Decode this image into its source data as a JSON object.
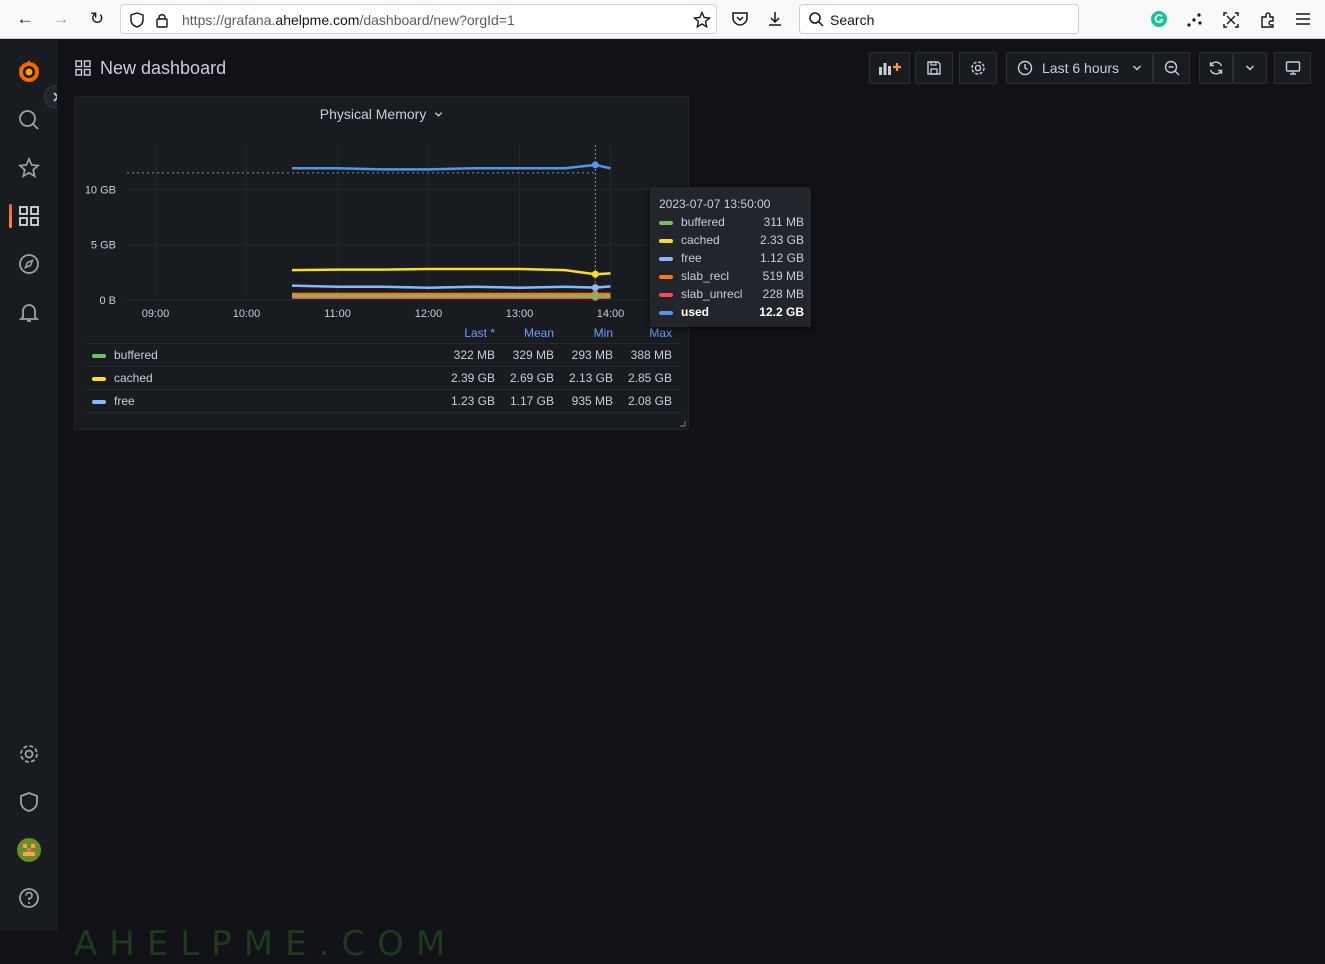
{
  "browser": {
    "url_prefix": "https://grafana.",
    "url_domain": "ahelpme.com",
    "url_path": "/dashboard/new?orgId=1",
    "search_placeholder": "Search"
  },
  "dashboard": {
    "title": "New dashboard",
    "time_range": "Last 6 hours"
  },
  "panel": {
    "title": "Physical Memory",
    "y_ticks": [
      "10 GB",
      "5 GB",
      "0 B"
    ],
    "x_ticks": [
      "09:00",
      "10:00",
      "11:00",
      "12:00",
      "13:00",
      "14:00"
    ]
  },
  "legend": {
    "headers": [
      "Last *",
      "Mean",
      "Min",
      "Max"
    ],
    "rows": [
      {
        "name": "buffered",
        "color": "#73bf69",
        "values": [
          "322 MB",
          "329 MB",
          "293 MB",
          "388 MB"
        ]
      },
      {
        "name": "cached",
        "color": "#fade2a",
        "values": [
          "2.39 GB",
          "2.69 GB",
          "2.13 GB",
          "2.85 GB"
        ]
      },
      {
        "name": "free",
        "color": "#8ab8ff",
        "values": [
          "1.23 GB",
          "1.17 GB",
          "935 MB",
          "2.08 GB"
        ]
      }
    ]
  },
  "tooltip": {
    "time": "2023-07-07 13:50:00",
    "rows": [
      {
        "name": "buffered",
        "color": "#73bf69",
        "value": "311 MB"
      },
      {
        "name": "cached",
        "color": "#fade2a",
        "value": "2.33 GB"
      },
      {
        "name": "free",
        "color": "#8ab8ff",
        "value": "1.12 GB"
      },
      {
        "name": "slab_recl",
        "color": "#ff780a",
        "value": "519 MB"
      },
      {
        "name": "slab_unrecl",
        "color": "#f2495c",
        "value": "228 MB"
      },
      {
        "name": "used",
        "color": "#5794f2",
        "value": "12.2 GB"
      }
    ]
  },
  "chart_data": {
    "type": "line",
    "ylim": [
      0,
      14
    ],
    "x": [
      "10:30",
      "11:00",
      "11:30",
      "12:00",
      "12:30",
      "13:00",
      "13:30",
      "13:50",
      "14:00"
    ],
    "series": [
      {
        "name": "used",
        "color": "#5794f2",
        "values": [
          11.9,
          11.9,
          11.8,
          11.8,
          11.9,
          11.9,
          11.9,
          12.2,
          11.9
        ]
      },
      {
        "name": "cached",
        "color": "#fade2a",
        "values": [
          2.7,
          2.75,
          2.75,
          2.8,
          2.8,
          2.8,
          2.7,
          2.33,
          2.4
        ]
      },
      {
        "name": "free",
        "color": "#8ab8ff",
        "values": [
          1.3,
          1.2,
          1.2,
          1.1,
          1.2,
          1.1,
          1.2,
          1.12,
          1.23
        ]
      },
      {
        "name": "slab_recl",
        "color": "#ff780a",
        "values": [
          0.52,
          0.52,
          0.52,
          0.52,
          0.52,
          0.52,
          0.52,
          0.519,
          0.52
        ]
      },
      {
        "name": "slab_unrecl",
        "color": "#f2495c",
        "values": [
          0.23,
          0.23,
          0.23,
          0.23,
          0.23,
          0.23,
          0.23,
          0.228,
          0.23
        ]
      },
      {
        "name": "buffered",
        "color": "#73bf69",
        "values": [
          0.33,
          0.33,
          0.33,
          0.33,
          0.33,
          0.33,
          0.33,
          0.311,
          0.32
        ]
      }
    ]
  },
  "watermark": "AHELPME.COM"
}
